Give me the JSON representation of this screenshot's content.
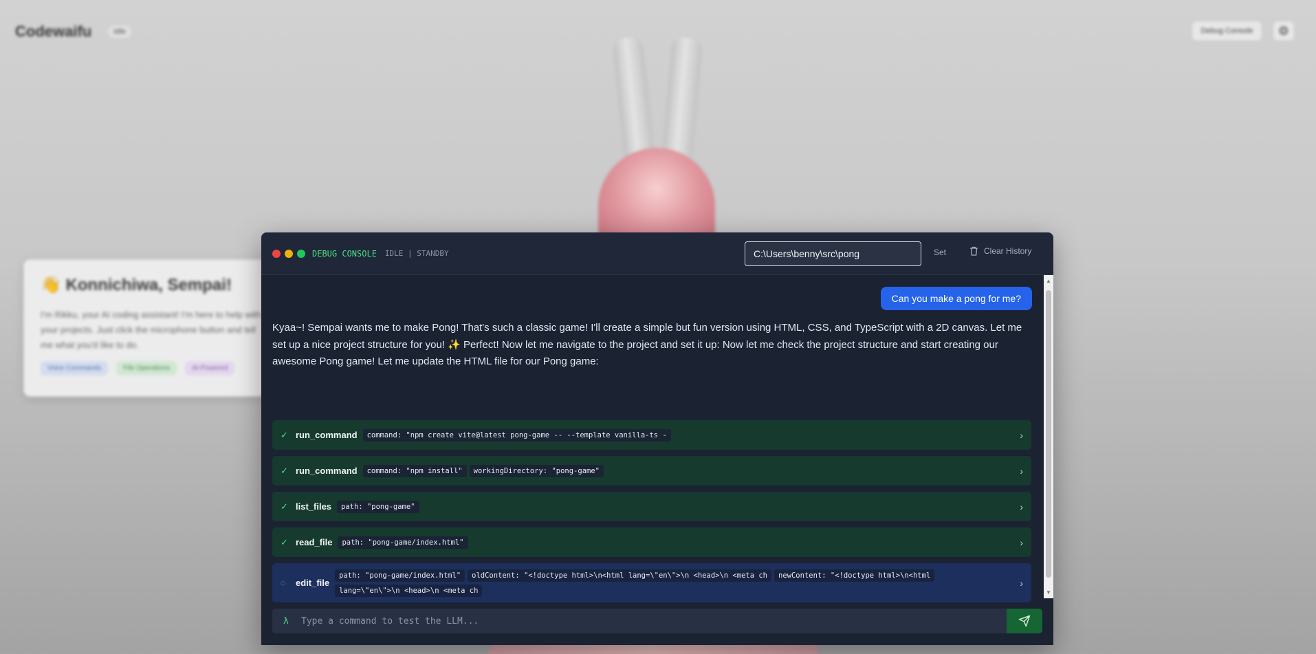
{
  "app": {
    "title": "Codewaifu",
    "status": "Idle",
    "debug_button": "Debug Console",
    "settings_icon": "gear-icon"
  },
  "welcome": {
    "emoji": "👋",
    "heading": "Konnichiwa, Sempai!",
    "body": "I'm Rikku, your AI coding assistant! I'm here to help with your projects. Just click the microphone button and tell me what you'd like to do.",
    "tags": [
      "Voice Commands",
      "File Operations",
      "AI-Powered"
    ]
  },
  "console": {
    "title": "DEBUG CONSOLE",
    "state": "IDLE | STANDBY",
    "path_value": "C:\\Users\\benny\\src\\pong",
    "set_label": "Set",
    "clear_label": "Clear History",
    "user_message": "Can you make a pong for me?",
    "ai_message": "Kyaa~! Sempai wants me to make Pong! That's such a classic game! I'll create a simple but fun version using HTML, CSS, and TypeScript with a 2D canvas. Let me set up a nice project structure for you! ✨ Perfect! Now let me navigate to the project and set it up: Now let me check the project structure and start creating our awesome Pong game! Let me update the HTML file for our Pong game:",
    "tools": [
      {
        "name": "run_command",
        "status": "done",
        "args": [
          "command: \"npm create vite@latest pong-game -- --template vanilla-ts -"
        ]
      },
      {
        "name": "run_command",
        "status": "done",
        "args": [
          "command: \"npm install\"",
          "workingDirectory: \"pong-game\""
        ]
      },
      {
        "name": "list_files",
        "status": "done",
        "args": [
          "path: \"pong-game\""
        ]
      },
      {
        "name": "read_file",
        "status": "done",
        "args": [
          "path: \"pong-game/index.html\""
        ]
      },
      {
        "name": "edit_file",
        "status": "running",
        "args": [
          "path: \"pong-game/index.html\"",
          "oldContent: \"<!doctype html>\\n<html lang=\\\"en\\\">\\n <head>\\n <meta ch",
          "newContent: \"<!doctype html>\\n<html",
          "lang=\\\"en\\\">\\n <head>\\n <meta ch"
        ]
      }
    ],
    "input_prompt": "λ",
    "input_placeholder": "Type a command to test the LLM...",
    "colors": {
      "accent_green": "#4ade80",
      "user_bubble": "#2563eb",
      "panel_bg": "#1b2232"
    }
  }
}
